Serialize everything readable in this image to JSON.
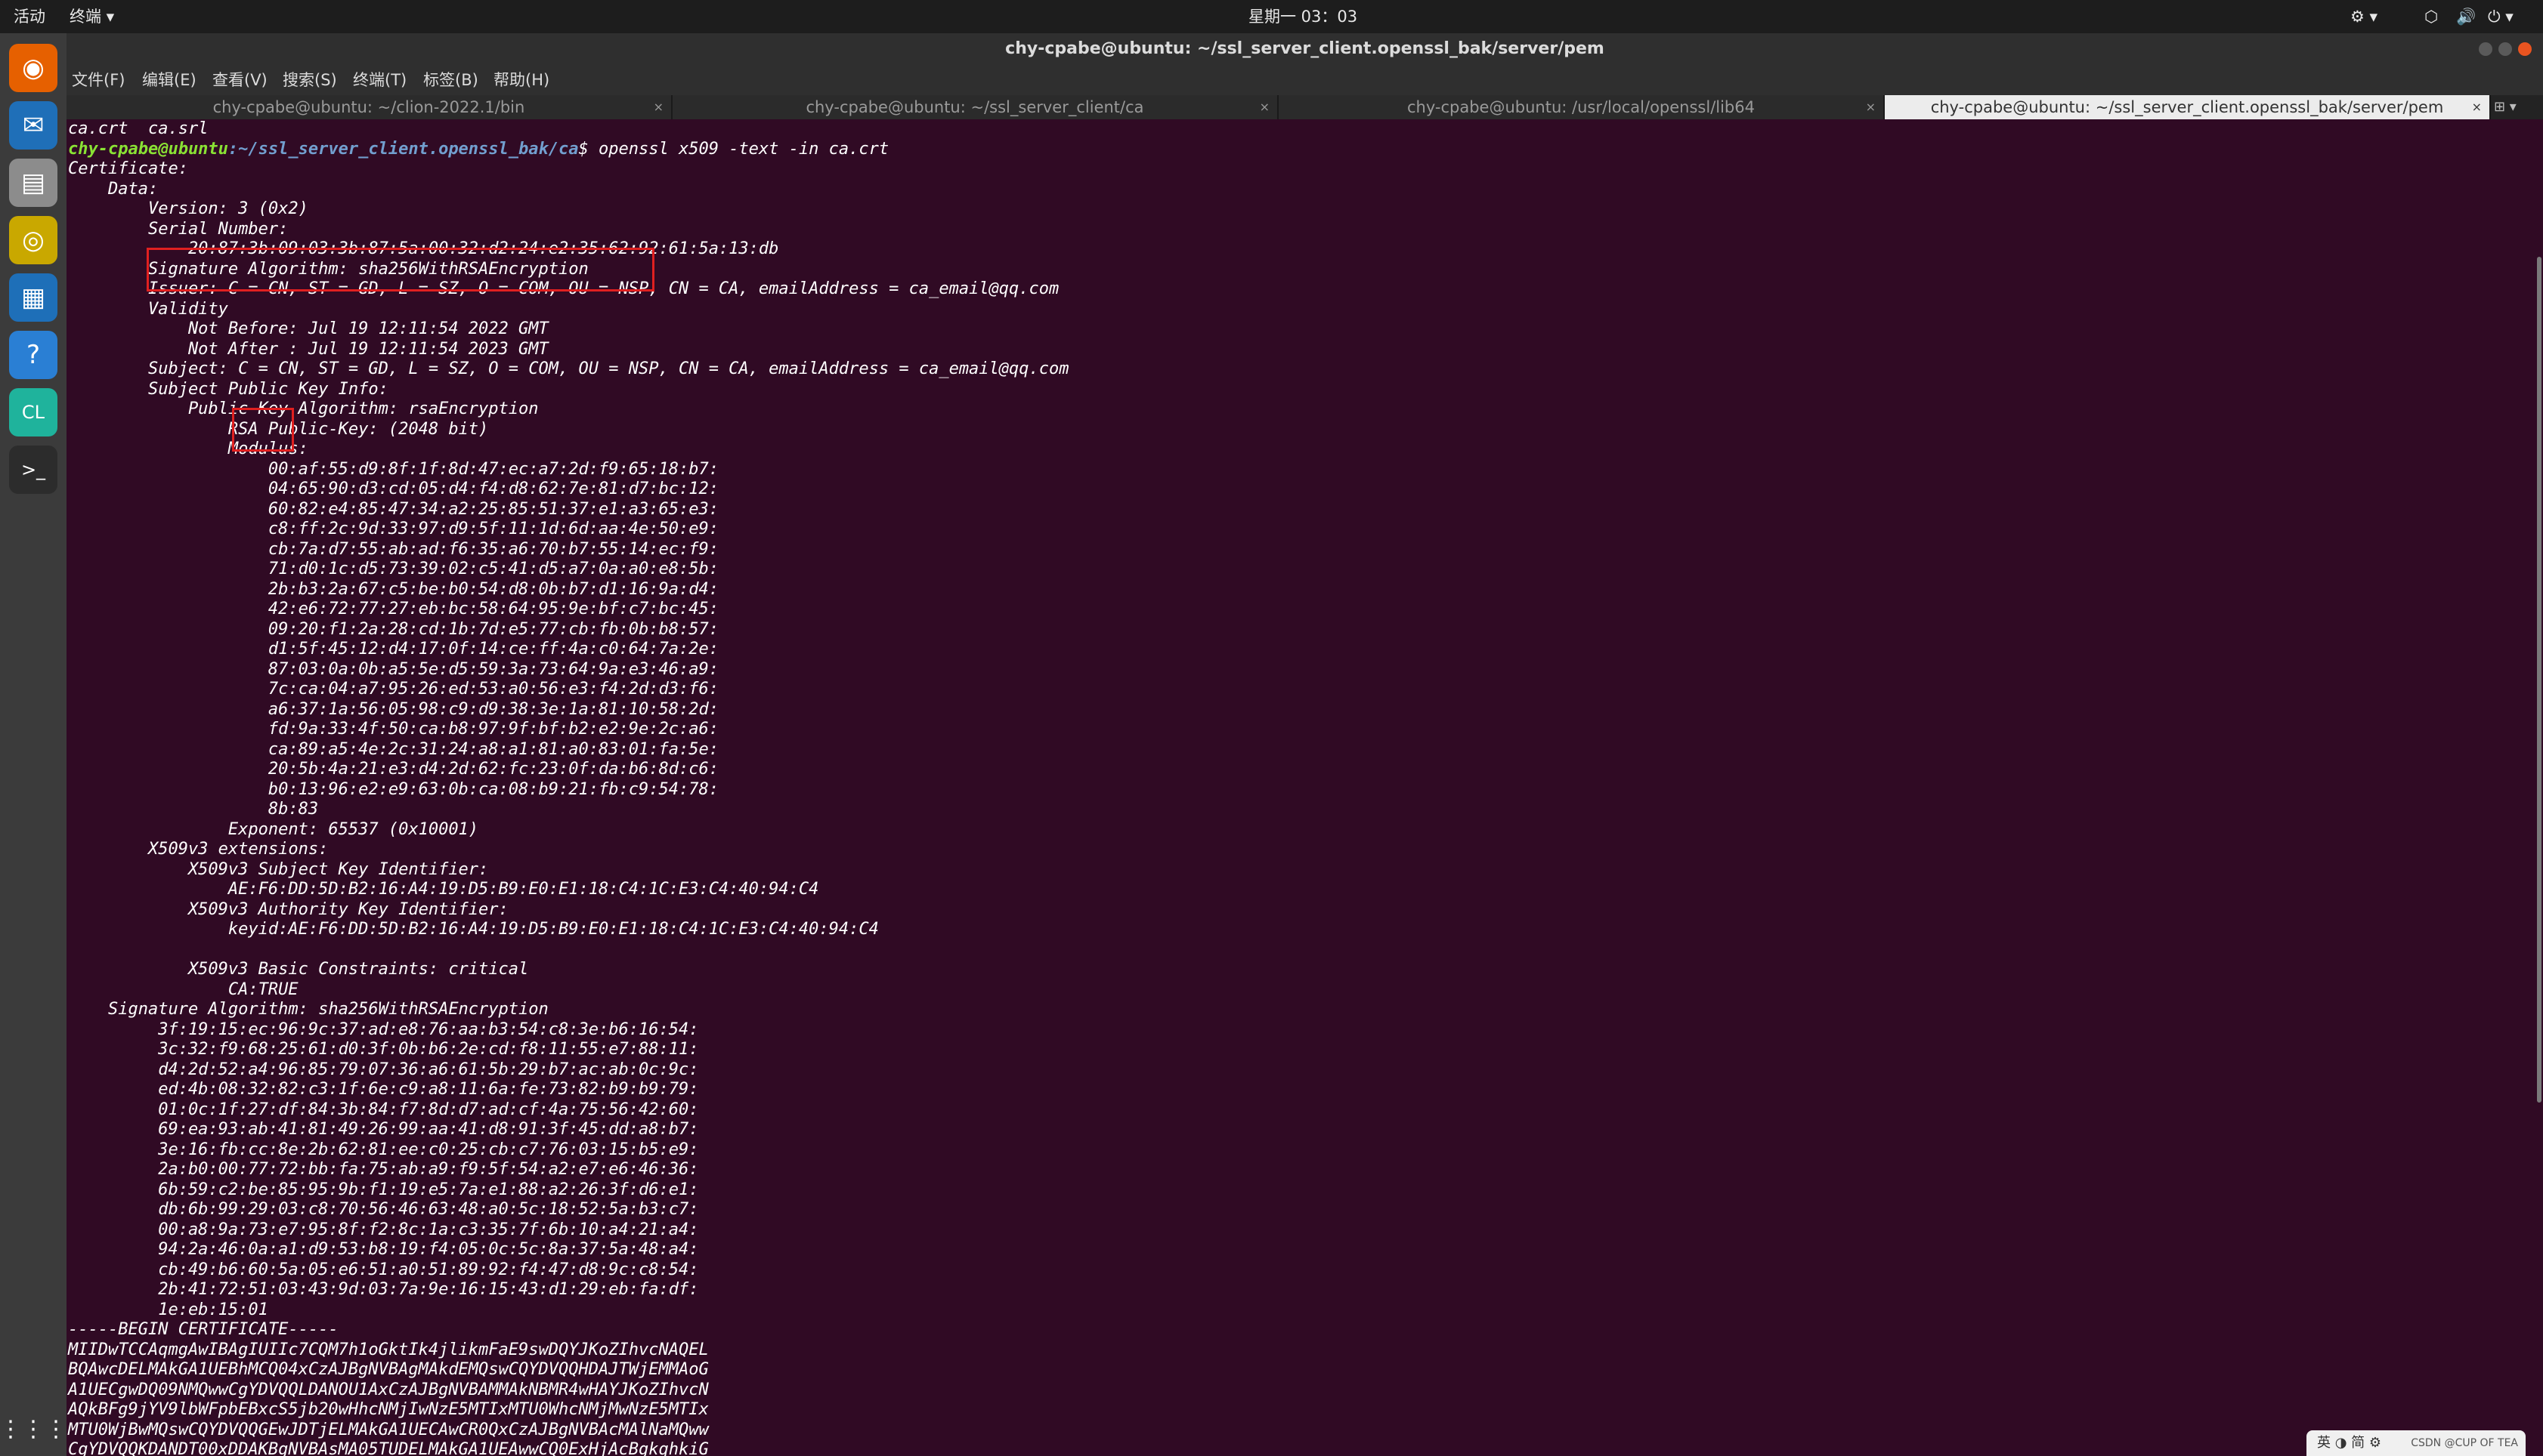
{
  "topbar": {
    "activities": "活动",
    "app_menu": "终端 ▾",
    "clock": "星期一 03：03",
    "tray": [
      "⚙ ▾",
      "⬡",
      "🔊",
      "⏻ ▾"
    ]
  },
  "dock": {
    "apps": [
      {
        "name": "firefox",
        "glyph": "◉",
        "color": "#e66000"
      },
      {
        "name": "thunderbird",
        "glyph": "✉",
        "color": "#1f6fb8"
      },
      {
        "name": "files",
        "glyph": "▤",
        "color": "#8c8c8c"
      },
      {
        "name": "rhythmbox",
        "glyph": "◎",
        "color": "#c9a800"
      },
      {
        "name": "writer",
        "glyph": "▦",
        "color": "#1e6fb8"
      },
      {
        "name": "help",
        "glyph": "?",
        "color": "#2a7fd4"
      },
      {
        "name": "clion",
        "glyph": "CL",
        "color": "#1fb39c"
      },
      {
        "name": "terminal",
        "glyph": ">_",
        "color": "#2c2c2c"
      }
    ],
    "grid": "⋮⋮⋮"
  },
  "window": {
    "title": "chy-cpabe@ubuntu: ~/ssl_server_client.openssl_bak/server/pem",
    "menu": [
      "文件(F)",
      "编辑(E)",
      "查看(V)",
      "搜索(S)",
      "终端(T)",
      "标签(B)",
      "帮助(H)"
    ],
    "tabs": [
      {
        "label": "chy-cpabe@ubuntu: ~/clion-2022.1/bin",
        "active": false
      },
      {
        "label": "chy-cpabe@ubuntu: ~/ssl_server_client/ca",
        "active": false
      },
      {
        "label": "chy-cpabe@ubuntu: /usr/local/openssl/lib64",
        "active": false
      },
      {
        "label": "chy-cpabe@ubuntu: ~/ssl_server_client.openssl_bak/server/pem",
        "active": true
      }
    ],
    "tab_close": "×"
  },
  "terminal": {
    "prev_output": "ca.crt  ca.srl",
    "prompt_user": "chy-cpabe@ubuntu",
    "prompt_path": ":~/ssl_server_client.openssl_bak/ca",
    "prompt_cmd": "$ openssl x509 -text -in ca.crt",
    "lines": [
      "Certificate:",
      "    Data:",
      "        Version: 3 (0x2)",
      "        Serial Number:",
      "            20:87:3b:09:03:3b:87:5a:00:32:d2:24:e2:35:62:92:61:5a:13:db",
      "        Signature Algorithm: sha256WithRSAEncryption",
      "        Issuer: C = CN, ST = GD, L = SZ, O = COM, OU = NSP, CN = CA, emailAddress = ca_email@qq.com",
      "        Validity",
      "            Not Before: Jul 19 12:11:54 2022 GMT",
      "            Not After : Jul 19 12:11:54 2023 GMT",
      "        Subject: C = CN, ST = GD, L = SZ, O = COM, OU = NSP, CN = CA, emailAddress = ca_email@qq.com",
      "        Subject Public Key Info:",
      "            Public Key Algorithm: rsaEncryption",
      "                RSA Public-Key: (2048 bit)",
      "                Modulus:",
      "                    00:af:55:d9:8f:1f:8d:47:ec:a7:2d:f9:65:18:b7:",
      "                    04:65:90:d3:cd:05:d4:f4:d8:62:7e:81:d7:bc:12:",
      "                    60:82:e4:85:47:34:a2:25:85:51:37:e1:a3:65:e3:",
      "                    c8:ff:2c:9d:33:97:d9:5f:11:1d:6d:aa:4e:50:e9:",
      "                    cb:7a:d7:55:ab:ad:f6:35:a6:70:b7:55:14:ec:f9:",
      "                    71:d0:1c:d5:73:39:02:c5:41:d5:a7:0a:a0:e8:5b:",
      "                    2b:b3:2a:67:c5:be:b0:54:d8:0b:b7:d1:16:9a:d4:",
      "                    42:e6:72:77:27:eb:bc:58:64:95:9e:bf:c7:bc:45:",
      "                    09:20:f1:2a:28:cd:1b:7d:e5:77:cb:fb:0b:b8:57:",
      "                    d1:5f:45:12:d4:17:0f:14:ce:ff:4a:c0:64:7a:2e:",
      "                    87:03:0a:0b:a5:5e:d5:59:3a:73:64:9a:e3:46:a9:",
      "                    7c:ca:04:a7:95:26:ed:53:a0:56:e3:f4:2d:d3:f6:",
      "                    a6:37:1a:56:05:98:c9:d9:38:3e:1a:81:10:58:2d:",
      "                    fd:9a:33:4f:50:ca:b8:97:9f:bf:b2:e2:9e:2c:a6:",
      "                    ca:89:a5:4e:2c:31:24:a8:a1:81:a0:83:01:fa:5e:",
      "                    20:5b:4a:21:e3:d4:2d:62:fc:23:0f:da:b6:8d:c6:",
      "                    b0:13:96:e2:e9:63:0b:ca:08:b9:21:fb:c9:54:78:",
      "                    8b:83",
      "                Exponent: 65537 (0x10001)",
      "        X509v3 extensions:",
      "            X509v3 Subject Key Identifier:",
      "                AE:F6:DD:5D:B2:16:A4:19:D5:B9:E0:E1:18:C4:1C:E3:C4:40:94:C4",
      "            X509v3 Authority Key Identifier:",
      "                keyid:AE:F6:DD:5D:B2:16:A4:19:D5:B9:E0:E1:18:C4:1C:E3:C4:40:94:C4",
      "",
      "            X509v3 Basic Constraints: critical",
      "                CA:TRUE",
      "    Signature Algorithm: sha256WithRSAEncryption",
      "         3f:19:15:ec:96:9c:37:ad:e8:76:aa:b3:54:c8:3e:b6:16:54:",
      "         3c:32:f9:68:25:61:d0:3f:0b:b6:2e:cd:f8:11:55:e7:88:11:",
      "         d4:2d:52:a4:96:85:79:07:36:a6:61:5b:29:b7:ac:ab:0c:9c:",
      "         ed:4b:08:32:82:c3:1f:6e:c9:a8:11:6a:fe:73:82:b9:b9:79:",
      "         01:0c:1f:27:df:84:3b:84:f7:8d:d7:ad:cf:4a:75:56:42:60:",
      "         69:ea:93:ab:41:81:49:26:99:aa:41:d8:91:3f:45:dd:a8:b7:",
      "         3e:16:fb:cc:8e:2b:62:81:ee:c0:25:cb:c7:76:03:15:b5:e9:",
      "         2a:b0:00:77:72:bb:fa:75:ab:a9:f9:5f:54:a2:e7:e6:46:36:",
      "         6b:59:c2:be:85:95:9b:f1:19:e5:7a:e1:88:a2:26:3f:d6:e1:",
      "         db:6b:99:29:03:c8:70:56:46:63:48:a0:5c:18:52:5a:b3:c7:",
      "         00:a8:9a:73:e7:95:8f:f2:8c:1a:c3:35:7f:6b:10:a4:21:a4:",
      "         94:2a:46:0a:a1:d9:53:b8:19:f4:05:0c:5c:8a:37:5a:48:a4:",
      "         cb:49:b6:60:5a:05:e6:51:a0:51:89:92:f4:47:d8:9c:c8:54:",
      "         2b:41:72:51:03:43:9d:03:7a:9e:16:15:43:d1:29:eb:fa:df:",
      "         1e:eb:15:01",
      "-----BEGIN CERTIFICATE-----",
      "MIIDwTCCAqmgAwIBAgIUIIc7CQM7h1oGktIk4jlikmFaE9swDQYJKoZIhvcNAQEL",
      "BQAwcDELMAkGA1UEBhMCQ04xCzAJBgNVBAgMAkdEMQswCQYDVQQHDAJTWjEMMAoG",
      "A1UECgwDQ09NMQwwCgYDVQQLDANOU1AxCzAJBgNVBAMMAkNBMR4wHAYJKoZIhvcN",
      "AQkBFg9jYV9lbWFpbEBxcS5jb20wHhcNMjIwNzE5MTIxMTU0WhcNMjMwNzE5MTIx",
      "MTU0WjBwMQswCQYDVQQGEwJDTjELMAkGA1UECAwCR0QxCzAJBgNVBAcMAlNaMQww",
      "CgYDVQQKDANDT00xDDAKBgNVBAsMA05TUDELMAkGA1UEAwwCQ0ExHjAcBgkqhkiG"
    ]
  },
  "widget": {
    "ime": "英 ◑ 简 ⚙",
    "watermark": "CSDN @CUP OF TEA"
  }
}
